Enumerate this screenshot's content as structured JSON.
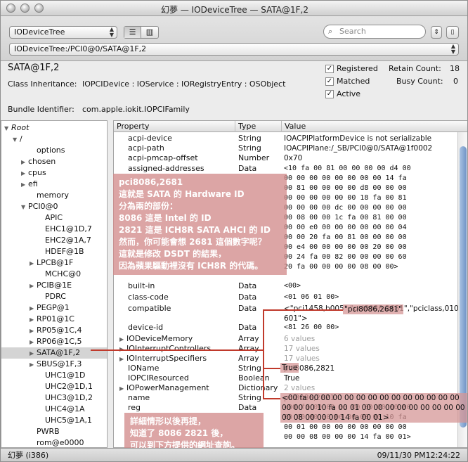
{
  "window": {
    "title": "幻夢 — IODeviceTree — SATA@1F,2"
  },
  "toolbar": {
    "plane_popup": "IODeviceTree",
    "path_popup": "IODeviceTree:/PCI0@0/SATA@1F,2",
    "search_placeholder": "Search"
  },
  "info": {
    "name": "SATA@1F,2",
    "class_label": "Class Inheritance:",
    "class_value": "IOPCIDevice : IOService : IORegistryEntry : OSObject",
    "bundle_label": "Bundle Identifier:",
    "bundle_value": "com.apple.iokit.IOPCIFamily",
    "registered": "Registered",
    "matched": "Matched",
    "active": "Active",
    "retain_label": "Retain Count:",
    "retain_value": "18",
    "busy_label": "Busy Count:",
    "busy_value": "0"
  },
  "tree": [
    {
      "label": "Root",
      "italic": true,
      "tri": "▼"
    },
    {
      "label": "/",
      "tri": "▼"
    },
    {
      "label": "options",
      "tri": ""
    },
    {
      "label": "chosen",
      "tri": "▶"
    },
    {
      "label": "cpus",
      "tri": "▶"
    },
    {
      "label": "efi",
      "tri": "▶"
    },
    {
      "label": "memory",
      "tri": ""
    },
    {
      "label": "PCI0@0",
      "tri": "▼"
    },
    {
      "label": "APIC",
      "tri": ""
    },
    {
      "label": "EHC1@1D,7",
      "tri": ""
    },
    {
      "label": "EHC2@1A,7",
      "tri": ""
    },
    {
      "label": "HDEF@1B",
      "tri": ""
    },
    {
      "label": "LPCB@1F",
      "tri": "▶"
    },
    {
      "label": "MCHC@0",
      "tri": ""
    },
    {
      "label": "PCIB@1E",
      "tri": "▶"
    },
    {
      "label": "PDRC",
      "tri": ""
    },
    {
      "label": "PEGP@1",
      "tri": "▶"
    },
    {
      "label": "RP01@1C",
      "tri": "▶"
    },
    {
      "label": "RP05@1C,4",
      "tri": "▶"
    },
    {
      "label": "RP06@1C,5",
      "tri": "▶"
    },
    {
      "label": "SATA@1F,2",
      "tri": "▶",
      "selected": true
    },
    {
      "label": "SBUS@1F,3",
      "tri": "▶"
    },
    {
      "label": "UHC1@1D",
      "tri": ""
    },
    {
      "label": "UHC2@1D,1",
      "tri": ""
    },
    {
      "label": "UHC3@1D,2",
      "tri": ""
    },
    {
      "label": "UHC4@1A",
      "tri": ""
    },
    {
      "label": "UHC5@1A,1",
      "tri": ""
    },
    {
      "label": "PWRB",
      "tri": ""
    },
    {
      "label": "rom@e0000",
      "tri": ""
    }
  ],
  "columns": {
    "property": "Property",
    "type": "Type",
    "value": "Value"
  },
  "rows": [
    {
      "p": "acpi-device",
      "t": "String",
      "v": "IOACPIPlatformDevice is not serializable",
      "plain": true
    },
    {
      "p": "acpi-path",
      "t": "String",
      "v": "IOACPIPlane:/_SB/PCI0@0/SATA@1f0002",
      "plain": true
    },
    {
      "p": "acpi-pmcap-offset",
      "t": "Number",
      "v": "0x70",
      "plain": true
    },
    {
      "p": "assigned-addresses",
      "t": "Data",
      "v": "<10 fa 00 81 00 00 00 00 d4 00\n00 00 00 00 00 00 00 00 14 fa\n00 81 00 00 00 00 d8 00 00 00\n00 00 00 00 00 00 18 fa 00 81\n00 00 00 00 dc 00 00 00 00 00\n00 08 00 00 1c fa 00 81 00 00\n00 00 e0 00 00 00 00 00 00 04\n00 00 20 fa 00 81 00 00 00 00\n00 e4 00 00 00 00 00 20 00 00\n00 24 fa 00 82 00 00 00 00 60\n20 fa 00 00 00 00 08 00 00>"
    },
    {
      "p": "built-in",
      "t": "Data",
      "v": "<00>"
    },
    {
      "p": "class-code",
      "t": "Data",
      "v": "<01 06 01 00>"
    },
    {
      "p": "compatible",
      "t": "Data",
      "v": "<\"pci1458,b005\",\"pci8086,2681\",\"pciclass,010\n601\">",
      "plain": true
    },
    {
      "p": "device-id",
      "t": "Data",
      "v": "<81 26 00 00>"
    },
    {
      "p": "IODeviceMemory",
      "t": "Array",
      "v": "6 values",
      "tri": true,
      "grey": true
    },
    {
      "p": "IOInterruptControllers",
      "t": "Array",
      "v": "17 values",
      "tri": true,
      "grey": true
    },
    {
      "p": "IOInterruptSpecifiers",
      "t": "Array",
      "v": "17 values",
      "tri": true,
      "grey": true
    },
    {
      "p": "IOName",
      "t": "String",
      "v": "pci8086,2821",
      "plain": true
    },
    {
      "p": "IOPCIResourced",
      "t": "Boolean",
      "v": "True",
      "plain": true
    },
    {
      "p": "IOPowerManagement",
      "t": "Dictionary",
      "v": "2 values",
      "tri": true,
      "grey": true
    },
    {
      "p": "name",
      "t": "String",
      "v": "pci8086,2821",
      "plain": true
    },
    {
      "p": "reg",
      "t": "Data",
      "v": "<00 fa 00 00 00 00 00 00 00 00\n00 00 00 00 00 00 00 00 10 fa\n00 01 00 00 00 00 00 00 00 00\n00 00 08 00 00 00 14 fa 00 01>"
    }
  ],
  "annotations": {
    "note1": [
      "pci8086,2681",
      "這就是 SATA 的 Hardware ID",
      "分為兩的部份：",
      "8086 這是 Intel 的 ID",
      "2821 這是 ICH8R SATA AHCI 的 ID",
      "然而，你可能會想 2681 這個數字呢？",
      "這就是修改 DSDT 的結果，",
      "因為蘋果驅動裡沒有 ICH8R 的代碼。"
    ],
    "note2": [
      "詳細情形以後再提，",
      "知道了 8086 2821 後，",
      "可以到下方提供的網址查詢。"
    ],
    "highlight_compatible": "\"pci8086,2681\""
  },
  "status": {
    "left": "幻夢 (i386)",
    "right": "09/11/30 PM12:24:22"
  }
}
